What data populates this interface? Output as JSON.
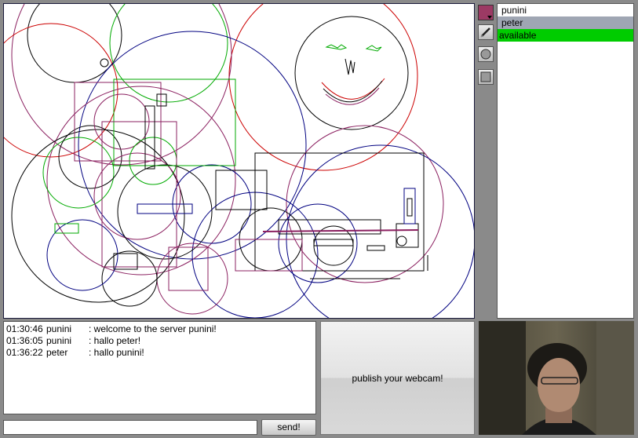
{
  "toolbar": {
    "color_value": "#9c3a64",
    "tools": [
      "color-picker",
      "pencil",
      "circle",
      "rectangle"
    ]
  },
  "users": {
    "items": [
      {
        "name": "punini",
        "selected": false
      },
      {
        "name": "peter",
        "selected": true
      }
    ],
    "status": "available",
    "status_color": "#00cc00"
  },
  "chat": {
    "messages": [
      {
        "time": "01:30:46",
        "user": "punini",
        "text": ": welcome to the server punini!"
      },
      {
        "time": "01:36:05",
        "user": "punini",
        "text": ": hallo peter!"
      },
      {
        "time": "01:36:22",
        "user": "peter",
        "text": ": hallo punini!"
      }
    ],
    "input_value": "",
    "send_label": "send!"
  },
  "video": {
    "publish_label": "publish your webcam!"
  },
  "drawing": {
    "stroke_colors": [
      "#000000",
      "#00aa00",
      "#8b2060",
      "#000080",
      "#cc0000"
    ]
  }
}
